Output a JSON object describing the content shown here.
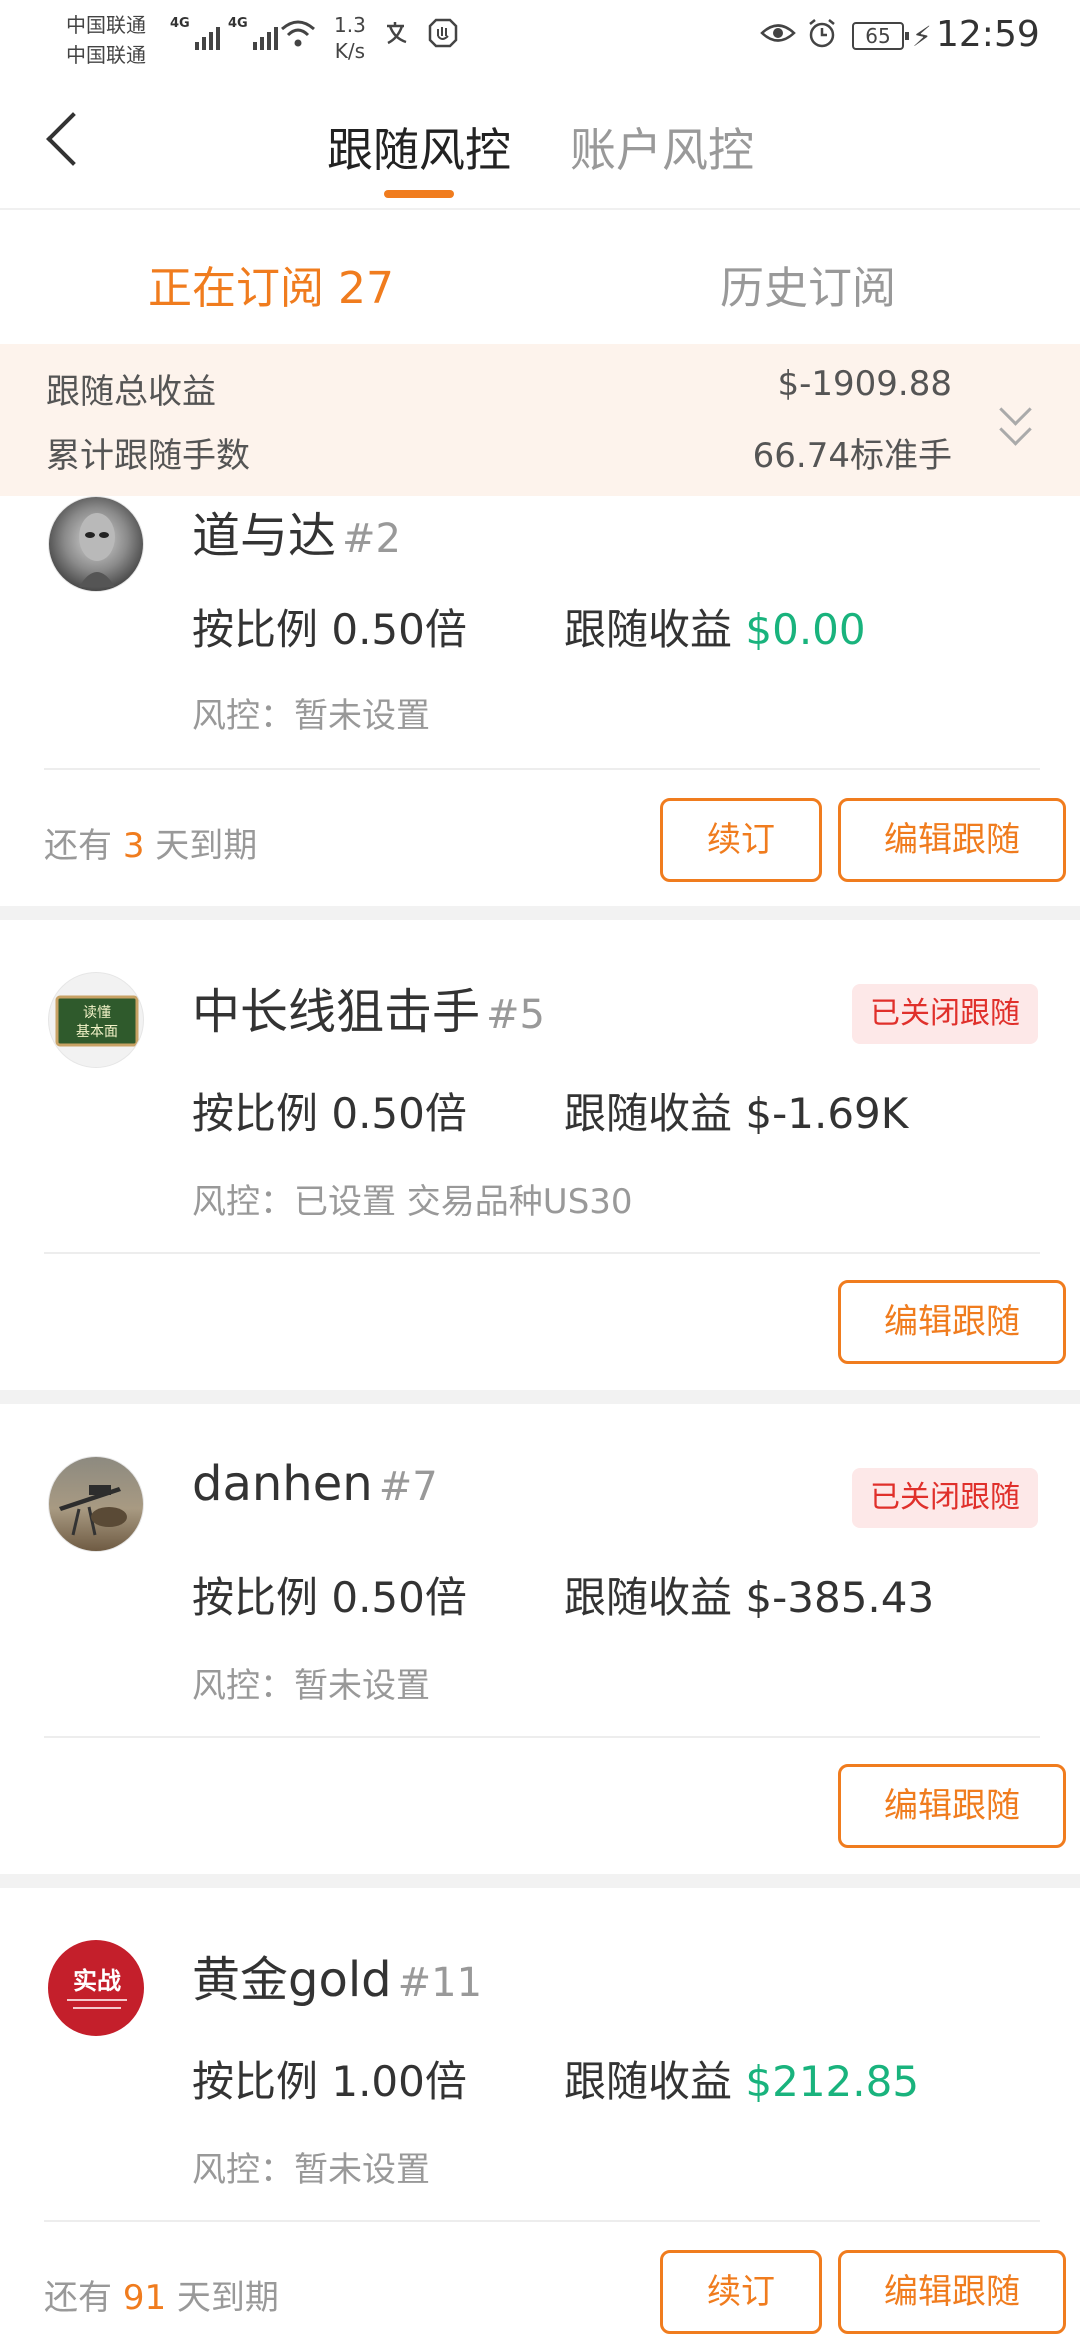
{
  "status_bar": {
    "carrier1": "中国联通",
    "carrier2": "中国联通",
    "network": "4G",
    "network2": "4G",
    "speed_value": "1.3",
    "speed_unit": "K/s",
    "battery": "65",
    "time": "12:59"
  },
  "header": {
    "tabs": [
      {
        "label": "跟随风控",
        "active": true
      },
      {
        "label": "账户风控",
        "active": false
      }
    ]
  },
  "subtabs": {
    "active_label": "正在订阅 27",
    "inactive_label": "历史订阅"
  },
  "summary": {
    "total_profit_label": "跟随总收益",
    "total_profit_value": "$-1909.88",
    "total_lots_label": "累计跟随手数",
    "total_lots_value": "66.74标准手"
  },
  "cards": [
    {
      "name": "道与达",
      "rank": "#2",
      "ratio": "按比例 0.50倍",
      "profit_label": "跟随收益",
      "profit_value": "$0.00",
      "risk": "风控：暂未设置",
      "expire_prefix": "还有",
      "expire_days": "3",
      "expire_suffix": "天到期",
      "renew_label": "续订",
      "edit_label": "编辑跟随"
    },
    {
      "name": "中长线狙击手",
      "rank": "#5",
      "closed_label": "已关闭跟随",
      "ratio": "按比例 0.50倍",
      "profit_label": "跟随收益",
      "profit_value": "$-1.69K",
      "risk": "风控：已设置 交易品种US30",
      "edit_label": "编辑跟随"
    },
    {
      "name": "danhen",
      "rank": "#7",
      "closed_label": "已关闭跟随",
      "ratio": "按比例 0.50倍",
      "profit_label": "跟随收益",
      "profit_value": "$-385.43",
      "risk": "风控：暂未设置",
      "edit_label": "编辑跟随"
    },
    {
      "name": "黄金gold",
      "rank": "#11",
      "avatar_text": "实战",
      "ratio": "按比例 1.00倍",
      "profit_label": "跟随收益",
      "profit_value": "$212.85",
      "risk": "风控：暂未设置",
      "expire_prefix": "还有",
      "expire_days": "91",
      "expire_suffix": "天到期",
      "renew_label": "续订",
      "edit_label": "编辑跟随"
    }
  ],
  "avatar2_text": {
    "line1": "读懂",
    "line2": "基本面"
  },
  "colors": {
    "accent": "#f07c1e",
    "positive": "#19b37d",
    "closed": "#e0302b",
    "summary_bg": "#fdf3ec"
  }
}
